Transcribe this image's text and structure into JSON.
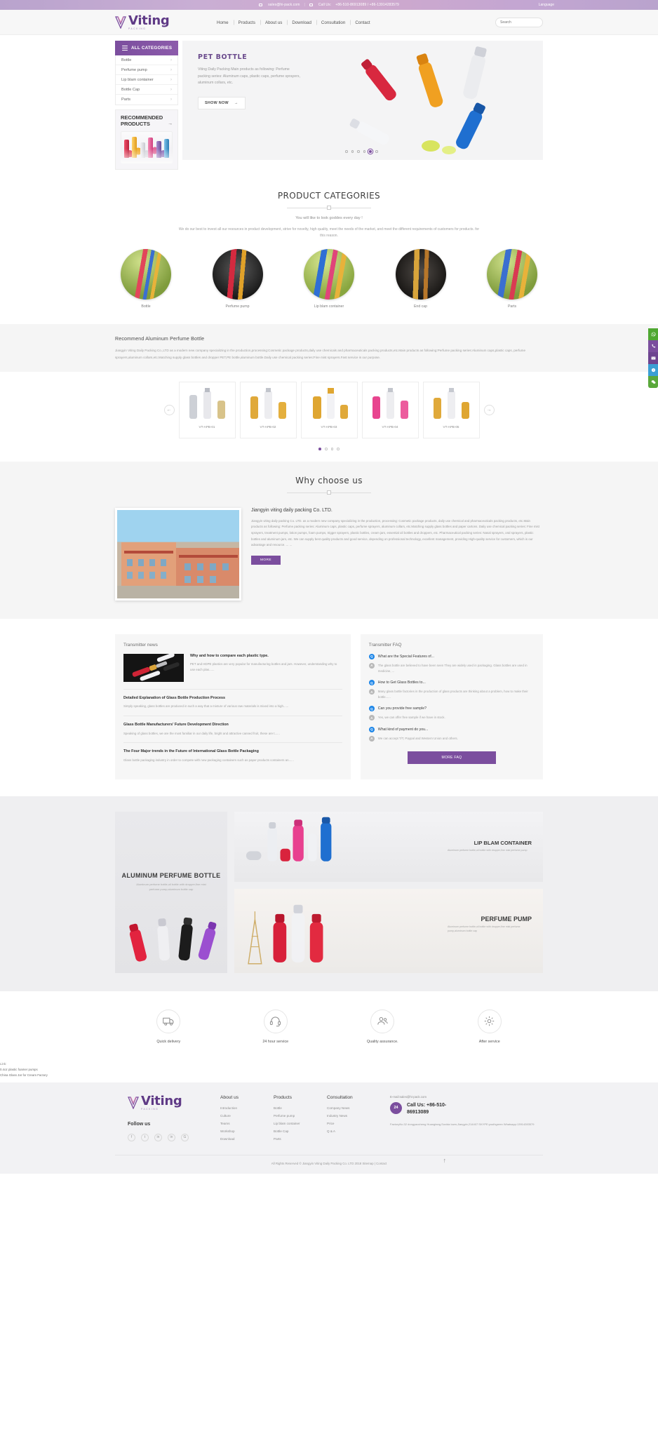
{
  "topbar": {
    "email": "sales@hi-pack.com",
    "separator": "|",
    "call_label": "Call Us:",
    "phones": "+86-510-86913089 /  +86-13914283579",
    "language": "Language"
  },
  "header": {
    "logo_name": "Viting",
    "logo_sub": "PACKING",
    "nav": [
      {
        "label": "Home"
      },
      {
        "label": "Products"
      },
      {
        "label": "About us"
      },
      {
        "label": "Download"
      },
      {
        "label": "Consultation"
      },
      {
        "label": "Contact"
      }
    ],
    "search_placeholder": "Search"
  },
  "hero": {
    "categories_title": "ALL CATEGORIES",
    "categories": [
      {
        "label": "Bottle"
      },
      {
        "label": "Perfume pump"
      },
      {
        "label": "Lip blam container"
      },
      {
        "label": "Bottle Cap"
      },
      {
        "label": "Parts"
      }
    ],
    "recommended_title": "RECOMMENDED PRODUCTS",
    "recommended_arrow": "→",
    "banner_title": "PET BOTTLE",
    "banner_desc": "Viting Daily Packing Main products as following: Perfume packing series: Aluminum caps, plastic caps, perfume sprayers, aluminum collars, etc.",
    "banner_cta": "SHOW NOW",
    "banner_cta_arrow": "→",
    "slide_count": 6,
    "active_slide": 5
  },
  "categories_section": {
    "title": "PRODUCT CATEGORIES",
    "subtitle": "You will like to look goddes every day !",
    "description": "We do our best to invest all our resources in product development, strive for novelty, high quality, meet the needs of the market, and meet the different requirements of customers for products. for this reason.",
    "items": [
      {
        "label": "Bottle"
      },
      {
        "label": "Perfume pump"
      },
      {
        "label": "Lip blam container"
      },
      {
        "label": "End cap"
      },
      {
        "label": "Parts"
      }
    ]
  },
  "recommend_block": {
    "title": "Recommend Aluminum Perfume Bottle",
    "body": "Jiangyin Viting Daily Packing Co.,LTD as a modern new company specializing in the production,processing:Cosmetic package products,daily use chemicals and pharmaceuticals packing products,etc.Main products as following:Perfume packing series:Aluminum caps,plastic caps, perfume sprayers,aluminum collars,etc.Matching supply glass bottles and dropper PET,PE bottle,aluminum bottle.Daily use chemical packing series:Fine mist sprayers.Fast service is our purpose."
  },
  "product_slider": {
    "prev": "←",
    "next": "→",
    "items": [
      {
        "code": "VT-APB-01"
      },
      {
        "code": "VT-APB-02"
      },
      {
        "code": "VT-APB-03"
      },
      {
        "code": "VT-APB-04"
      },
      {
        "code": "VT-APB-05"
      }
    ],
    "dot_count": 4,
    "active_dot": 0
  },
  "why": {
    "title": "Why choose us",
    "company": "Jiangyin viting daily packing Co. LTD.",
    "body": "Jiangyin viting daily packing Co. LTD. as a modern new company specializing in the production,  processing: Cosmetic package products, daily use chemical and pharmaceuticals packing products, etc.Main products as following: Perfume packing series: Aluminum caps, plastic caps, perfume sprayers, aluminum collars, etc.Matching supply glass bottles and paper cartons. Daily use chemical packing series: Fine mist sprayers, treatment pumps, lotion pumps, foam pumps, trigger sprayers, plastic bottles, cream jars, essential oil bottles and droppers, etc. Pharmaceutical packing series: Nasal sprayers, oral sprayers, plastic bottles and aluminum jars, etc. We can supply best quality products and good service, depending on professional technology, excellent management, providing High-quality service for customers, which is our advantage and resource. ... ...",
    "more": "MORE"
  },
  "news": {
    "title": "Transmitter news",
    "lead": {
      "title": "Why and how to compare each plastic type.",
      "excerpt": "PET and HDPE plastics are very popular for manufacturing bottles and jars. However, understanding why to use each plas......"
    },
    "items": [
      {
        "title": "Detailed Explanation of Glass Bottle Production Process",
        "excerpt": "Simply speaking, glass bottles are produced in such a way that a mixture of various raw materials is mixed into a high......"
      },
      {
        "title": "Glass Bottle Manufacturers' Future Development Direction",
        "excerpt": "Speaking of glass bottles, we are the most familiar in our daily life, bright and attractive canned fruit, these are t......"
      },
      {
        "title": "The Four Major trends in the Future of International Glass Bottle Packaging",
        "excerpt": "Glass bottle packaging industry in order to compete with new packaging containers such as paper products containers an......"
      }
    ]
  },
  "faq": {
    "title": "Transmitter FAQ",
    "q_mark": "Q",
    "a_mark": "A",
    "items": [
      {
        "q": "What are the Special Features of...",
        "a": "The glass bottle are believed to have been seen They are widely used in packaging. Glass bottles are used in medicine, ..."
      },
      {
        "q": "How to Get Glass Bottles to...",
        "a": "Many glass bottle factories in the production of glass products are thinking about a problem, how to make their bottle......"
      },
      {
        "q": "Can you provide free sample?",
        "a": "Yes, we can offer free sample if we have in stock."
      },
      {
        "q": "What kind of payment do you...",
        "a": "We can accept T/T, Paypal and Western Union and others."
      }
    ],
    "more": "MORE FAQ"
  },
  "showcase": {
    "left": {
      "title": "ALUMINUM PERFUME BOTTLE",
      "sub": "Aluminum perfume bottle,oil bottle with dropper,fine mist perfume pump,aluminum bottle cap"
    },
    "top": {
      "title": "LIP BLAM CONTAINER",
      "sub": "Aluminum perfume bottle,oil bottle with dropper,fine mist perfume pump"
    },
    "bottom": {
      "title": "PERFUME PUMP",
      "sub": "Aluminum perfume bottle,oil bottle with dropper,fine mist perfume pump,aluminum bottle cap"
    }
  },
  "services": [
    {
      "label": "Quick delivery",
      "icon": "truck-icon"
    },
    {
      "label": "24 hour service",
      "icon": "headset-icon"
    },
    {
      "label": "Quality assurance.",
      "icon": "people-icon"
    },
    {
      "label": "After service",
      "icon": "gear-icon"
    }
  ],
  "links": {
    "label": "Link:",
    "items": [
      {
        "label": "0.4oz plastic foamer pumps"
      },
      {
        "label": "China Glass Jar for Cream Factory"
      }
    ]
  },
  "footer": {
    "logo_name": "Viting",
    "logo_sub": "PACKING",
    "follow_title": "Follow us",
    "socials": [
      "f",
      "t",
      "in",
      "in",
      "G"
    ],
    "columns": [
      {
        "title": "About us",
        "links": [
          {
            "label": "Introduction"
          },
          {
            "label": "Culture"
          },
          {
            "label": "Teams"
          },
          {
            "label": "Workshop"
          },
          {
            "label": "Download"
          }
        ]
      },
      {
        "title": "Products",
        "links": [
          {
            "label": "Bottle"
          },
          {
            "label": "Perfume pump"
          },
          {
            "label": "Lip blam container"
          },
          {
            "label": "Bottle Cap"
          },
          {
            "label": "Parts"
          }
        ]
      },
      {
        "title": "Consultation",
        "links": [
          {
            "label": "Company News"
          },
          {
            "label": "Industry News"
          },
          {
            "label": "Price"
          },
          {
            "label": "Q & A"
          }
        ]
      }
    ],
    "email_line": "E-mail:sales@hi-pack.com",
    "badge": "24",
    "call_label": "Call Us: +86-510-",
    "call_number": "86913089",
    "address": "FactoryNo.32 dongyaocheng Huangtang,Suxida town,Jiangyin,214407 SKYPE:youthgreen Whatsapp:13914283579",
    "copyright": "All Rights Reserved © Jiangyin Viting Daily Packing Co. LTD 2018  Sitemap | Contact",
    "to_top": "↑"
  },
  "side_tools": [
    {
      "name": "whatsapp-icon"
    },
    {
      "name": "phone-icon"
    },
    {
      "name": "email-icon"
    },
    {
      "name": "skype-icon"
    },
    {
      "name": "wechat-icon"
    }
  ]
}
